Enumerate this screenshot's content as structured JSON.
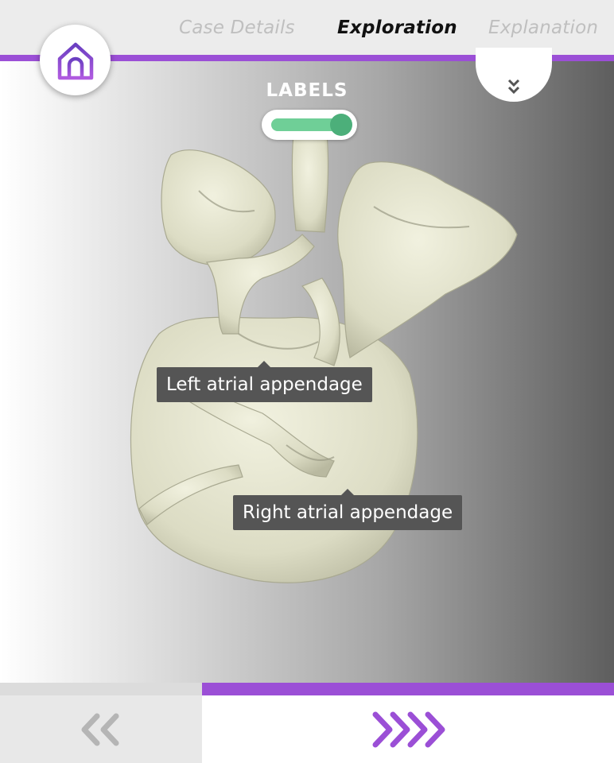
{
  "tabs": [
    {
      "label": "Case Details",
      "active": false
    },
    {
      "label": "Exploration",
      "active": true
    },
    {
      "label": "Explanation",
      "active": false
    }
  ],
  "labels_toggle": {
    "title": "LABELS",
    "enabled": true
  },
  "annotations": [
    {
      "text": "Left atrial appendage"
    },
    {
      "text": "Right atrial appendage"
    }
  ],
  "nav": {
    "prev_icon": "double-chevron-left-icon",
    "next_icon": "quad-chevron-right-icon"
  },
  "colors": {
    "accent": "#9b4fd6",
    "toggle_on": "#6fcf97",
    "model": "#e8e8d4"
  }
}
